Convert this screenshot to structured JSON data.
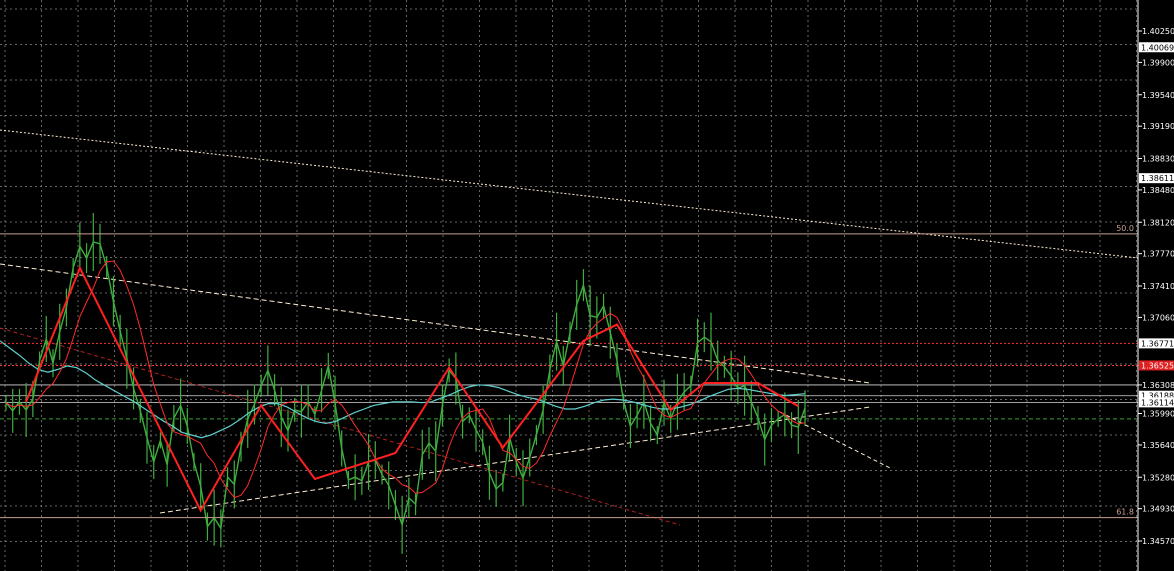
{
  "colors": {
    "background": "#000000",
    "grid": "#8a8a8a",
    "axis": "#ffffff",
    "price_line": "#3fae3f",
    "zigzag": "#ff2020",
    "ma_fast": "#ff2a2a",
    "ma_slow": "#5fd0d0",
    "trendline": "#ffeed0",
    "fib_level": "#c8a090",
    "level_red": "#ff3030",
    "level_green": "#33a033"
  },
  "chart_data": {
    "type": "line",
    "y_axis": {
      "position": "right",
      "range": [
        1.4449,
        1.4049
      ],
      "inverted_note": "",
      "ticks": [
        "1.40250",
        "1.39900",
        "1.39540",
        "1.39190",
        "1.38830",
        "1.38480",
        "1.38120",
        "1.37770",
        "1.37410",
        "1.37060",
        "1.36308",
        "1.35990",
        "1.35640",
        "1.35280",
        "1.34930",
        "1.34570"
      ],
      "tick_values": [
        1.4025,
        1.399,
        1.3954,
        1.3919,
        1.3883,
        1.3848,
        1.3812,
        1.3777,
        1.3741,
        1.3706,
        1.36308,
        1.3599,
        1.3564,
        1.3528,
        1.3493,
        1.3457
      ]
    },
    "boxed_labels": [
      {
        "text": "1.40069",
        "value": 1.40069,
        "style": "white"
      },
      {
        "text": "1.38611",
        "value": 1.38611,
        "style": "white"
      },
      {
        "text": "1.36771",
        "value": 1.36771,
        "style": "white"
      },
      {
        "text": "1.36525",
        "value": 1.36525,
        "style": "red"
      },
      {
        "text": "1.36188",
        "value": 1.36188,
        "style": "white"
      },
      {
        "text": "1.36114",
        "value": 1.36114,
        "style": "white"
      }
    ],
    "fib_levels": [
      {
        "label": "50.0",
        "value": 1.3799
      },
      {
        "label": "61.8",
        "value": 1.3483
      }
    ],
    "horizontal_levels": [
      {
        "value": 1.36771,
        "style": "red-dotted"
      },
      {
        "value": 1.36525,
        "style": "red-dotted"
      },
      {
        "value": 1.36308,
        "style": "white"
      },
      {
        "value": 1.36188,
        "style": "white"
      },
      {
        "value": 1.36114,
        "style": "white"
      },
      {
        "value": 1.3593,
        "style": "green-dashed"
      }
    ],
    "series": [
      {
        "values": [
          1.3611,
          1.3602,
          1.3612,
          1.3603,
          1.3615,
          1.3658,
          1.3682,
          1.3655,
          1.369,
          1.3717,
          1.3761,
          1.3785,
          1.3772,
          1.379,
          1.3788,
          1.3762,
          1.3724,
          1.3691,
          1.366,
          1.3627,
          1.3602,
          1.3572,
          1.3545,
          1.3569,
          1.3542,
          1.3594,
          1.3608,
          1.3585,
          1.3545,
          1.3518,
          1.3473,
          1.3483,
          1.3471,
          1.3528,
          1.352,
          1.3562,
          1.3593,
          1.3609,
          1.363,
          1.3647,
          1.3625,
          1.3595,
          1.358,
          1.3603,
          1.3601,
          1.3612,
          1.3598,
          1.3625,
          1.3652,
          1.3611,
          1.356,
          1.3525,
          1.3528,
          1.3524,
          1.3545,
          1.3547,
          1.3531,
          1.3519,
          1.3497,
          1.3475,
          1.3505,
          1.3498,
          1.3553,
          1.3566,
          1.3557,
          1.3608,
          1.3647,
          1.3638,
          1.359,
          1.3597,
          1.3581,
          1.3567,
          1.3533,
          1.3515,
          1.3522,
          1.3572,
          1.3545,
          1.3527,
          1.355,
          1.3575,
          1.3603,
          1.3648,
          1.3679,
          1.3652,
          1.3689,
          1.372,
          1.3742,
          1.3708,
          1.3706,
          1.3719,
          1.3689,
          1.3658,
          1.3612,
          1.3585,
          1.3597,
          1.3612,
          1.3588,
          1.3575,
          1.3611,
          1.3593,
          1.3612,
          1.3623,
          1.363,
          1.3678,
          1.3684,
          1.3679,
          1.3658,
          1.3651,
          1.3641,
          1.3627,
          1.363,
          1.3612,
          1.3594,
          1.357,
          1.3586,
          1.3593,
          1.3598,
          1.3586,
          1.3584,
          1.3605
        ]
      },
      {
        "name": "",
        "values": [
          1.368,
          1.3672,
          1.3664,
          1.3655,
          1.3648,
          1.3645,
          1.3648,
          1.3652,
          1.365,
          1.3644,
          1.3636,
          1.363,
          1.3624,
          1.3618,
          1.3612,
          1.3605,
          1.3598,
          1.3591,
          1.3585,
          1.3578,
          1.3575,
          1.3572,
          1.3575,
          1.358,
          1.3585,
          1.3592,
          1.36,
          1.3606,
          1.361,
          1.361,
          1.3606,
          1.36,
          1.3594,
          1.359,
          1.3588,
          1.359,
          1.3595,
          1.36,
          1.3604,
          1.3608,
          1.361,
          1.3612,
          1.3612,
          1.3612,
          1.3611,
          1.3612,
          1.3616,
          1.362,
          1.3625,
          1.3629,
          1.3631,
          1.363,
          1.3628,
          1.3624,
          1.362,
          1.3617,
          1.3615,
          1.3611,
          1.3607,
          1.3604,
          1.3604,
          1.3607,
          1.3611,
          1.3614,
          1.3615,
          1.3614,
          1.3612,
          1.3609,
          1.3606,
          1.3604,
          1.3604,
          1.3606,
          1.3609,
          1.3613,
          1.3618,
          1.3622,
          1.3626,
          1.3627,
          1.3626,
          1.3624,
          1.3622,
          1.362,
          1.3619,
          1.362,
          1.3621
        ]
      }
    ],
    "zigzag": [
      {
        "i": 3,
        "v": 1.3612
      },
      {
        "i": 11,
        "v": 1.3761
      },
      {
        "i": 29,
        "v": 1.3491
      },
      {
        "i": 38,
        "v": 1.3608
      },
      {
        "i": 46,
        "v": 1.3526
      },
      {
        "i": 58,
        "v": 1.3555
      },
      {
        "i": 66,
        "v": 1.365
      },
      {
        "i": 74,
        "v": 1.3561
      },
      {
        "i": 86,
        "v": 1.368
      },
      {
        "i": 91,
        "v": 1.3698
      },
      {
        "i": 99,
        "v": 1.3603
      },
      {
        "i": 104,
        "v": 1.3633
      },
      {
        "i": 112,
        "v": 1.3633
      },
      {
        "i": 118,
        "v": 1.3607
      }
    ]
  }
}
